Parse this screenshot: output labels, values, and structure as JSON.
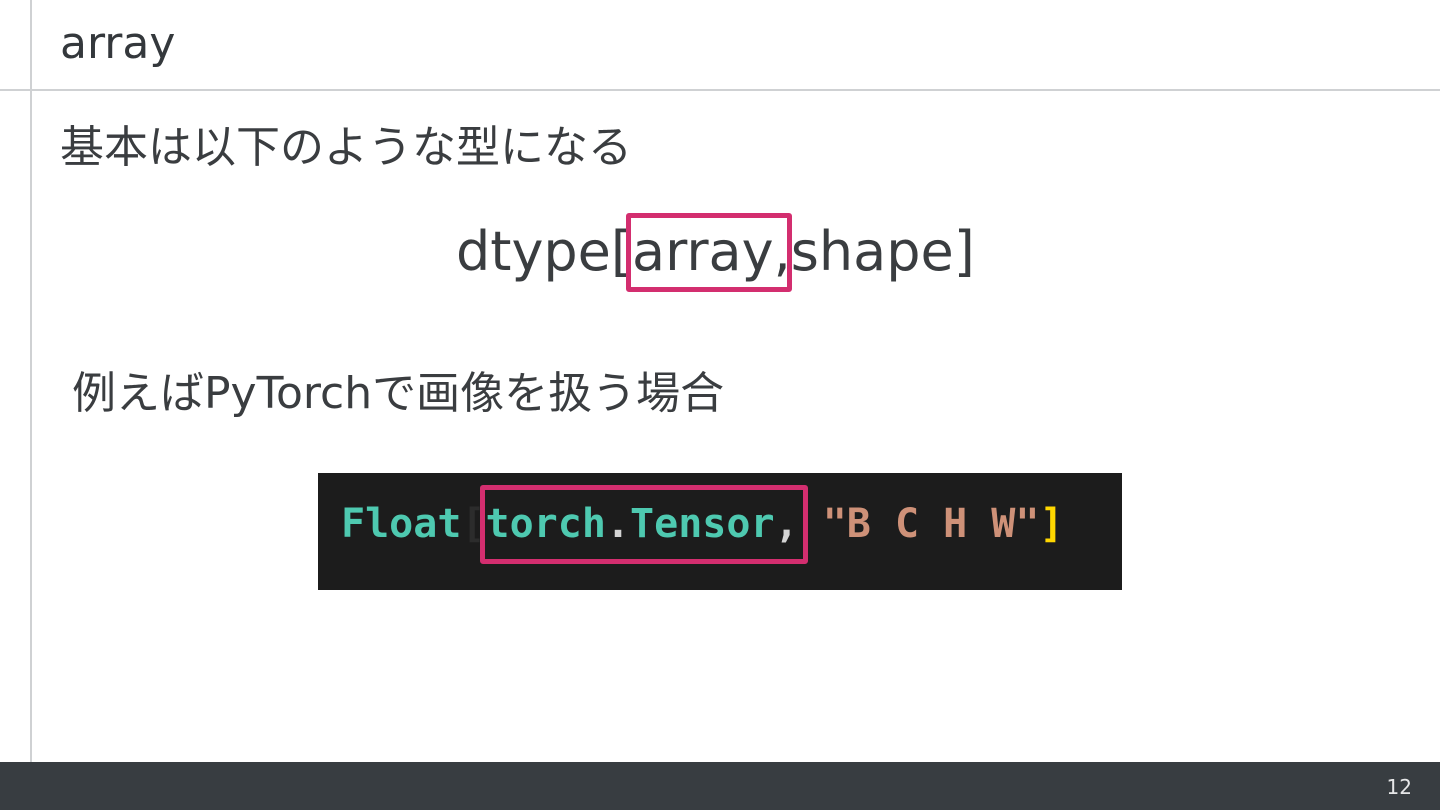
{
  "slide": {
    "title": "array",
    "lead": "基本は以下のような型になる",
    "type_expression": {
      "prefix": "dtype[",
      "highlight": "array,",
      "suffix": " shape]"
    },
    "example_heading": "例えばPyTorchで画像を扱う場合",
    "code": {
      "type_name": "Float",
      "open_bracket": "[",
      "module": "torch",
      "dot": ".",
      "class": "Tensor",
      "comma": ", ",
      "shape_string": "\"B C H W\"",
      "close_bracket": "]"
    },
    "page_number": "12"
  },
  "colors": {
    "highlight_border": "#d32e6f",
    "code_background": "#1c1c1c",
    "code_type": "#4ec9b0",
    "code_string": "#ce9178",
    "code_bracket": "#ffd700",
    "code_punct": "#d4d4d4",
    "footer_background": "#383d41"
  }
}
